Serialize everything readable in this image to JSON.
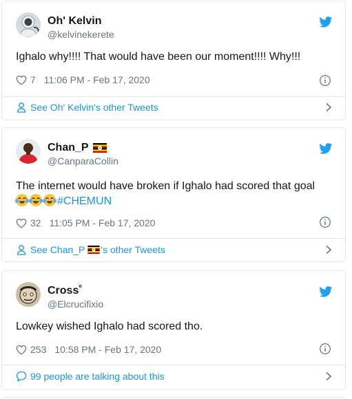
{
  "tweets": [
    {
      "name": "Oh' Kelvin",
      "handle": "@kelvinekerete",
      "text": "Ighalo why!!!! That would have been our moment!!!! Why!!!",
      "likes": "7",
      "timestamp": "11:06 PM - Feb 17, 2020",
      "footer_label": "See Oh' Kelvin's other Tweets",
      "footer_icon": "person-icon",
      "avatar": "avatar-astronaut"
    },
    {
      "name": "Chan_P",
      "name_flag": "uganda-flag",
      "handle": "@CanparaCollin",
      "text": "The internet would have broken if Ighalo had scored that goal",
      "emojis": [
        "face-with-tears-of-joy",
        "face-with-tears-of-joy",
        "face-with-tears-of-joy"
      ],
      "hashtag": "#CHEMUN",
      "likes": "32",
      "timestamp": "11:05 PM - Feb 17, 2020",
      "footer_prefix": "See Chan_P",
      "footer_suffix": "'s other Tweets",
      "footer_icon": "person-icon",
      "avatar": "avatar-man-red-shirt"
    },
    {
      "name": "Cross˚",
      "handle": "@Elcrucifixio",
      "text": "Lowkey wished Ighalo had scored tho.",
      "likes": "253",
      "timestamp": "10:58 PM - Feb 17, 2020",
      "footer_label": "99 people are talking about this",
      "footer_icon": "speech-bubble-icon",
      "avatar": "avatar-cartoon-face"
    }
  ],
  "icons": {
    "bird": "twitter-bird-icon",
    "heart": "heart-icon",
    "info": "info-icon",
    "chevron": "chevron-right-icon"
  },
  "colors": {
    "twitter_blue": "#1b95e0",
    "text": "#14171a",
    "secondary": "#657786",
    "border": "#e1e8ed"
  }
}
